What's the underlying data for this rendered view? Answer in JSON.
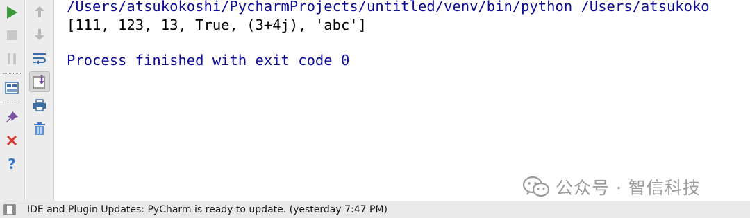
{
  "console": {
    "command_line": "/Users/atsukokoshi/PycharmProjects/untitled/venv/bin/python /Users/atsukoko",
    "output_line": "[111, 123, 13, True, (3+4j), 'abc']",
    "exit_line": "Process finished with exit code 0"
  },
  "left_toolbar": [
    {
      "name": "rerun-icon",
      "color": "#3c9a3c"
    },
    {
      "name": "stop-icon",
      "color": "#c8c8c8"
    },
    {
      "name": "pause-icon",
      "color": "#c8c8c8"
    },
    {
      "name": "restore-layout-icon",
      "color": "#3a6ea5"
    },
    {
      "name": "pin-tab-icon",
      "color": "#7a4fa0"
    },
    {
      "name": "close-icon",
      "color": "#d9352b"
    },
    {
      "name": "help-icon",
      "color": "#3a78c8"
    }
  ],
  "second_toolbar": [
    {
      "name": "up-stack-frame-icon",
      "color": "#b8b8b8"
    },
    {
      "name": "down-stack-frame-icon",
      "color": "#b8b8b8"
    },
    {
      "name": "soft-wrap-icon",
      "color": "#3a6ea5"
    },
    {
      "name": "scroll-to-end-icon",
      "color": "#7a4fa0"
    },
    {
      "name": "print-icon",
      "color": "#3a6ea5"
    },
    {
      "name": "clear-all-icon",
      "color": "#3a78c8"
    }
  ],
  "watermark": {
    "text": "公众号 · 智信科技"
  },
  "status_bar": {
    "message": "IDE and Plugin Updates: PyCharm is ready to update. (yesterday 7:47 PM)"
  }
}
